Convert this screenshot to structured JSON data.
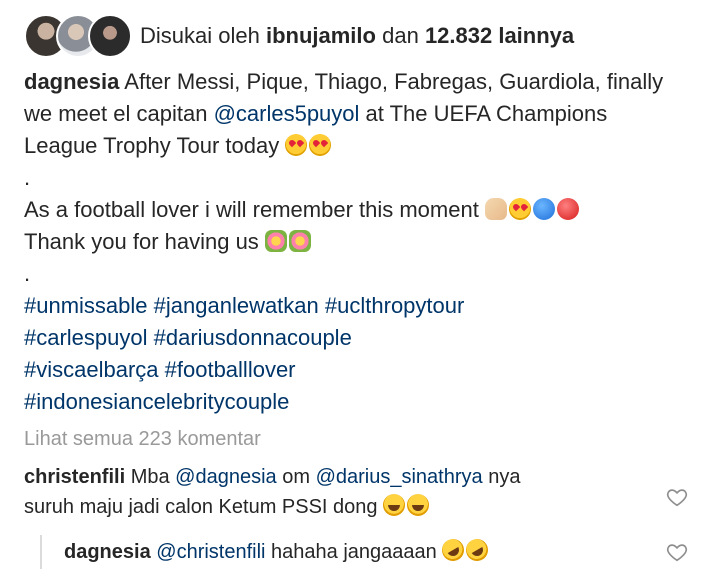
{
  "likes": {
    "prefix": "Disukai oleh",
    "user": "ibnujamilo",
    "middle": "dan",
    "count": "12.832 lainnya"
  },
  "post": {
    "username": "dagnesia",
    "line1": "After Messi, Pique, Thiago, Fabregas, Guardiola, finally",
    "line2_pre": "we meet el capitan",
    "line2_mention": "@carles5puyol",
    "line2_post": "at The UEFA Champions",
    "line3": "League Trophy Tour today",
    "dot1": ".",
    "line4": "As a football lover i will remember this moment",
    "line5": "Thank you for having us",
    "dot2": ".",
    "hashtags": {
      "h1": "#unmissable",
      "h2": "#janganlewatkan",
      "h3": "#uclthropytour",
      "h4": "#carlespuyol",
      "h5": "#dariusdonnacouple",
      "h6": "#viscaelbarça",
      "h7": "#footballlover",
      "h8": "#indonesiancelebritycouple"
    }
  },
  "comments": {
    "view_all": "Lihat semua 223 komentar",
    "c1": {
      "user": "christenfili",
      "text1": "Mba",
      "mention1": "@dagnesia",
      "text2": "om",
      "mention2": "@darius_sinathrya",
      "text3": "nya",
      "line2": "suruh maju jadi calon Ketum PSSI dong"
    },
    "reply": {
      "user": "dagnesia",
      "mention": "@christenfili",
      "text": "hahaha jangaaaan"
    }
  },
  "colors": {
    "text": "#262626",
    "link": "#003569",
    "muted": "#999999"
  },
  "icons": {
    "like": "heart-outline-icon"
  }
}
